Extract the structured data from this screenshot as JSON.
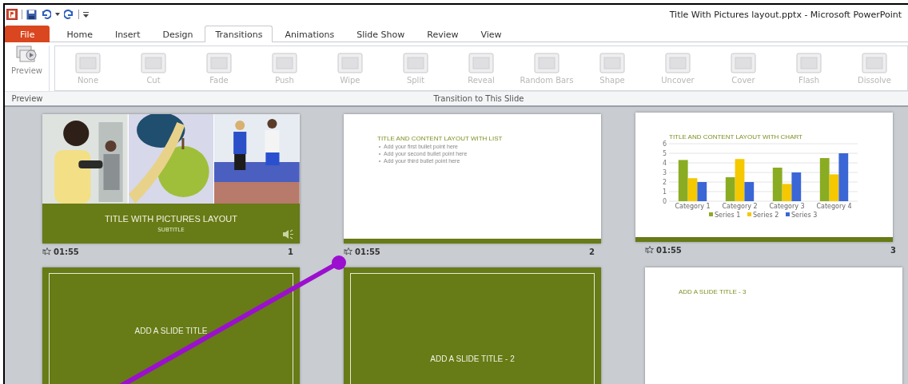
{
  "window": {
    "title": "Title With Pictures layout.pptx  -  Microsoft PowerPoint"
  },
  "tabs": [
    {
      "label": "File",
      "kind": "file",
      "selected": false
    },
    {
      "label": "Home",
      "kind": "tab",
      "selected": false
    },
    {
      "label": "Insert",
      "kind": "tab",
      "selected": false
    },
    {
      "label": "Design",
      "kind": "tab",
      "selected": false
    },
    {
      "label": "Transitions",
      "kind": "tab",
      "selected": true
    },
    {
      "label": "Animations",
      "kind": "tab",
      "selected": false
    },
    {
      "label": "Slide Show",
      "kind": "tab",
      "selected": false
    },
    {
      "label": "Review",
      "kind": "tab",
      "selected": false
    },
    {
      "label": "View",
      "kind": "tab",
      "selected": false
    }
  ],
  "ribbon": {
    "preview_button": {
      "label": "Preview"
    },
    "transitions": [
      {
        "label": "None",
        "disabled": true
      },
      {
        "label": "Cut",
        "disabled": true
      },
      {
        "label": "Fade",
        "disabled": true
      },
      {
        "label": "Push",
        "disabled": true
      },
      {
        "label": "Wipe",
        "disabled": true
      },
      {
        "label": "Split",
        "disabled": true
      },
      {
        "label": "Reveal",
        "disabled": true
      },
      {
        "label": "Random Bars",
        "disabled": true
      },
      {
        "label": "Shape",
        "disabled": true
      },
      {
        "label": "Uncover",
        "disabled": true
      },
      {
        "label": "Cover",
        "disabled": true
      },
      {
        "label": "Flash",
        "disabled": true
      },
      {
        "label": "Dissolve",
        "disabled": true
      }
    ],
    "group_labels": [
      "Preview",
      "Transition to This Slide"
    ]
  },
  "slides": [
    {
      "kind": "pictures",
      "title": "TITLE WITH PICTURES LAYOUT",
      "subtitle": "SUBTITLE",
      "has_sound": true,
      "time": "01:55",
      "number": "1"
    },
    {
      "kind": "list",
      "title": "TITLE AND CONTENT LAYOUT WITH LIST",
      "bullets": [
        "Add your first bullet point here",
        "Add your second bullet point here",
        "Add your third bullet point here"
      ],
      "time": "01:55",
      "number": "2"
    },
    {
      "kind": "chart",
      "title": "TITLE AND CONTENT LAYOUT WITH CHART",
      "time": "01:55",
      "number": "3",
      "chart_data": {
        "type": "bar",
        "categories": [
          "Category 1",
          "Category 2",
          "Category 3",
          "Category 4"
        ],
        "series": [
          {
            "name": "Series 1",
            "color": "#8aac22",
            "values": [
              4.3,
              2.5,
              3.5,
              4.5
            ]
          },
          {
            "name": "Series 2",
            "color": "#f5c800",
            "values": [
              2.4,
              4.4,
              1.8,
              2.8
            ]
          },
          {
            "name": "Series 3",
            "color": "#3b66d6",
            "values": [
              2,
              2,
              3,
              5
            ]
          }
        ],
        "ylim": [
          0,
          6
        ],
        "yticks": [
          0,
          1,
          2,
          3,
          4,
          5,
          6
        ],
        "grid": true,
        "legend": true
      }
    },
    {
      "kind": "green_title",
      "title": "ADD A SLIDE TITLE"
    },
    {
      "kind": "green_section",
      "title": "ADD A SLIDE TITLE - 2"
    },
    {
      "kind": "plain_title",
      "title": "ADD A SLIDE TITLE - 3"
    }
  ]
}
